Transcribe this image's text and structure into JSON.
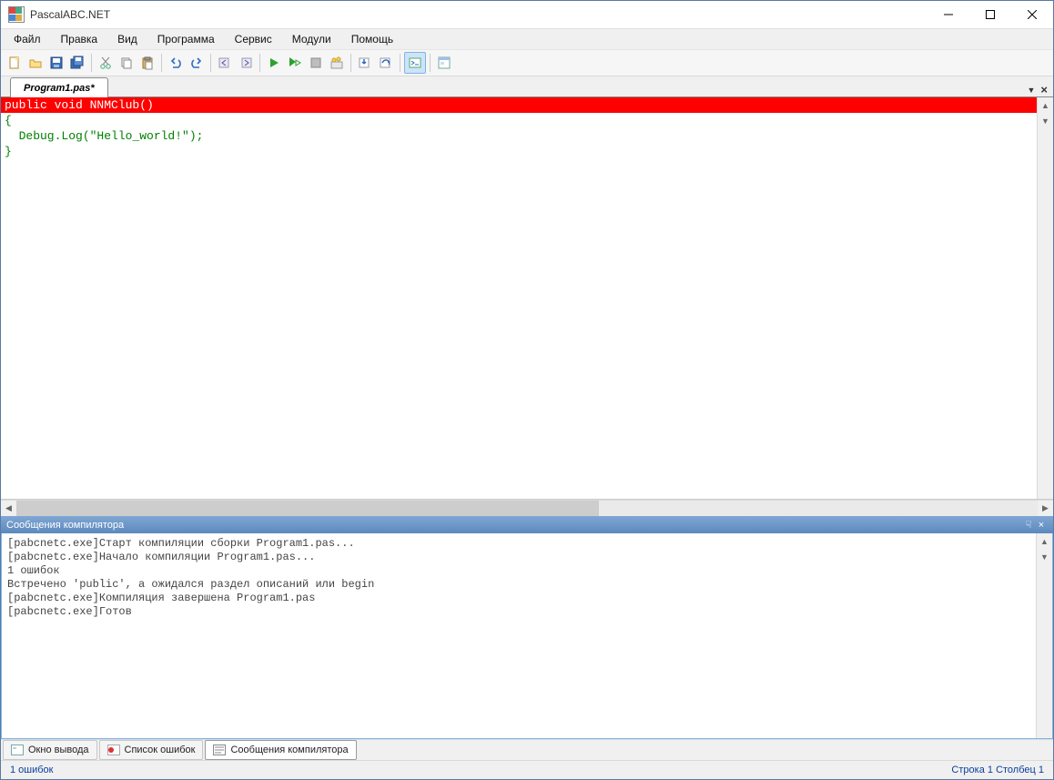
{
  "window": {
    "title": "PascalABC.NET"
  },
  "menu": {
    "items": [
      "Файл",
      "Правка",
      "Вид",
      "Программа",
      "Сервис",
      "Модули",
      "Помощь"
    ]
  },
  "tabs": {
    "active": "Program1.pas*"
  },
  "code": {
    "error_line": "public void NNMClub()",
    "line2": "{",
    "line3": "  Debug.Log(\"Hello_world!\");",
    "line4": "}"
  },
  "compiler_panel": {
    "title": "Сообщения компилятора"
  },
  "compiler_output": [
    "[pabcnetc.exe]Старт компиляции сборки Program1.pas...",
    "[pabcnetc.exe]Начало компиляции Program1.pas...",
    "1 ошибок",
    "Встречено 'public', а ожидался раздел описаний или begin",
    "[pabcnetc.exe]Компиляция завершена Program1.pas",
    "[pabcnetc.exe]Готов"
  ],
  "bottom_tabs": {
    "output": "Окно вывода",
    "errors": "Список ошибок",
    "compiler": "Сообщения компилятора"
  },
  "status": {
    "errors": "1 ошибок",
    "line_label": "Строка",
    "line": "1",
    "col_label": "Столбец",
    "col": "1"
  }
}
